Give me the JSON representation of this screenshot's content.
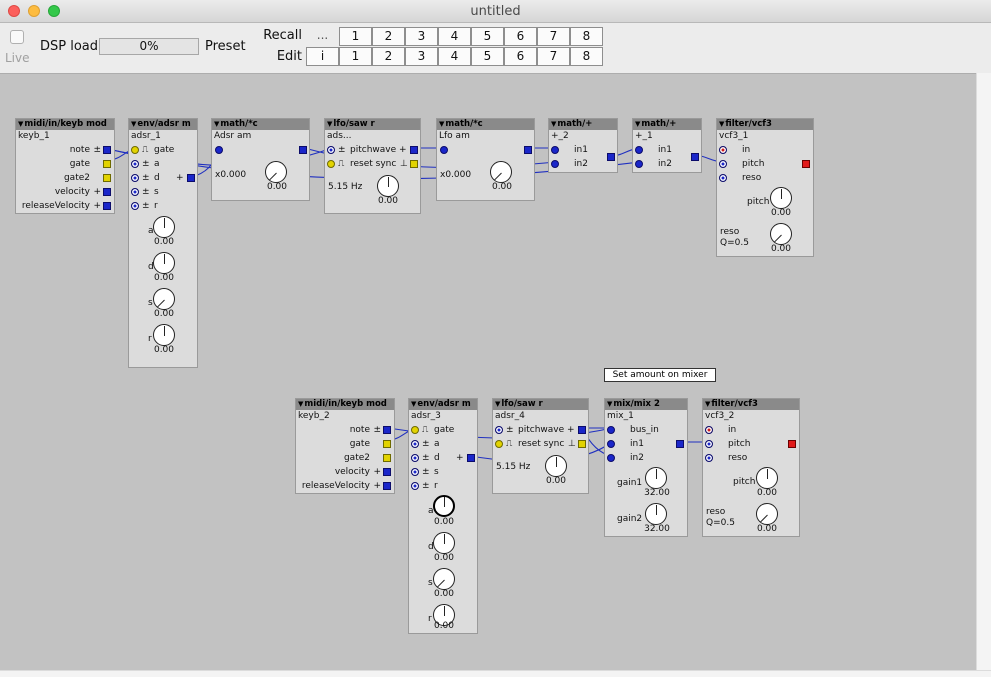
{
  "window": {
    "title": "untitled"
  },
  "toolbar": {
    "live_label": "Live",
    "dsp_label": "DSP load",
    "dsp_value": "0%",
    "preset_label": "Preset",
    "recall_label": "Recall",
    "edit_label": "Edit",
    "recall_extra": "...",
    "edit_extra": "i",
    "presets": [
      "1",
      "2",
      "3",
      "4",
      "5",
      "6",
      "7",
      "8"
    ]
  },
  "objects": {
    "keyb1": {
      "type": "midi/in/keyb mod",
      "name": "keyb_1",
      "ports": [
        "note",
        "gate",
        "gate2",
        "velocity",
        "releaseVelocity"
      ],
      "signs": [
        "±",
        "",
        "",
        "+",
        "+"
      ]
    },
    "env1": {
      "type": "env/adsr m",
      "name": "adsr_1",
      "ports": [
        "gate",
        "a",
        "d",
        "s",
        "r"
      ],
      "out_sign": "+",
      "knobs": [
        {
          "label": "a",
          "value": "0.00"
        },
        {
          "label": "d",
          "value": "0.00"
        },
        {
          "label": "s",
          "value": "0.00"
        },
        {
          "label": "r",
          "value": "0.00"
        }
      ]
    },
    "math1": {
      "type": "math/*c",
      "name": "Adsr am",
      "param": "x0.000",
      "value": "0.00"
    },
    "lfo1": {
      "type": "lfo/saw r",
      "name": "ads...",
      "ports": [
        "pitchwave",
        "reset sync"
      ],
      "freq": "5.15 Hz",
      "value": "0.00"
    },
    "math2": {
      "type": "math/*c",
      "name": "Lfo am",
      "param": "x0.000",
      "value": "0.00"
    },
    "plus2": {
      "type": "math/+",
      "name": "+_2",
      "ports": [
        "in1",
        "in2"
      ]
    },
    "plus1": {
      "type": "math/+",
      "name": "+_1",
      "ports": [
        "in1",
        "in2"
      ]
    },
    "vcf1": {
      "type": "filter/vcf3",
      "name": "vcf3_1",
      "ports": [
        "in",
        "pitch",
        "reso"
      ],
      "pitch_label": "pitch",
      "pitch_value": "0.00",
      "reso_label": "reso",
      "q_label": "Q=0.5",
      "reso_value": "0.00"
    },
    "keyb2": {
      "type": "midi/in/keyb mod",
      "name": "keyb_2",
      "ports": [
        "note",
        "gate",
        "gate2",
        "velocity",
        "releaseVelocity"
      ],
      "signs": [
        "±",
        "",
        "",
        "+",
        "+"
      ]
    },
    "env2": {
      "type": "env/adsr m",
      "name": "adsr_3",
      "ports": [
        "gate",
        "a",
        "d",
        "s",
        "r"
      ],
      "out_sign": "+",
      "knobs": [
        {
          "label": "a",
          "value": "0.00"
        },
        {
          "label": "d",
          "value": "0.00"
        },
        {
          "label": "s",
          "value": "0.00"
        },
        {
          "label": "r",
          "value": "0.00"
        }
      ]
    },
    "lfo2": {
      "type": "lfo/saw r",
      "name": "adsr_4",
      "ports": [
        "pitchwave",
        "reset sync"
      ],
      "freq": "5.15 Hz",
      "value": "0.00"
    },
    "mix1": {
      "type": "mix/mix 2",
      "name": "mix_1",
      "ports": [
        "bus_in",
        "in1",
        "in2"
      ],
      "gain1_label": "gain1",
      "gain1_value": "32.00",
      "gain2_label": "gain2",
      "gain2_value": "32.00"
    },
    "vcf2": {
      "type": "filter/vcf3",
      "name": "vcf3_2",
      "ports": [
        "in",
        "pitch",
        "reso"
      ],
      "pitch_label": "pitch",
      "pitch_value": "0.00",
      "reso_label": "reso",
      "q_label": "Q=0.5",
      "reso_value": "0.00"
    }
  },
  "comment": "Set amount on mixer",
  "colors": {
    "canvas": "#c2c2c2",
    "object": "#dcdcdc",
    "header": "#8a8a8a",
    "wire": "#2030c0",
    "bool_port": "#e2d300",
    "audio_port": "#e11a1a"
  }
}
